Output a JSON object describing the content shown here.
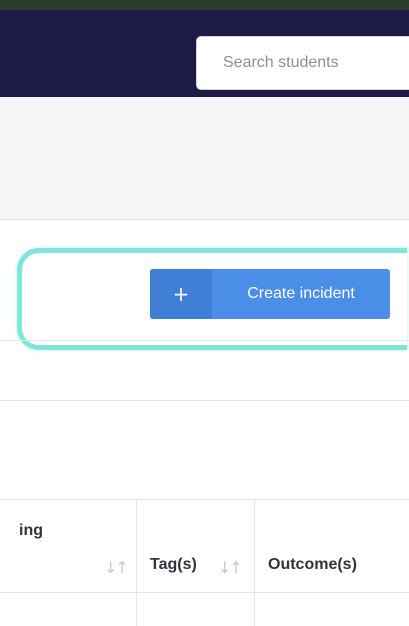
{
  "header": {
    "search_placeholder": "Search students",
    "colors": {
      "bar": "#1d1a46",
      "accent": "#4a8ee8",
      "highlight": "#7fe6dc"
    }
  },
  "toolbar": {
    "create_plus": "+",
    "create_label": "Create incident"
  },
  "table": {
    "columns": [
      {
        "label": "ing",
        "sort_icon": "sort-icon"
      },
      {
        "label": "Tag(s)",
        "sort_icon": "sort-icon"
      },
      {
        "label": "Outcome(s)"
      }
    ],
    "sort_glyph": "↓↑"
  }
}
